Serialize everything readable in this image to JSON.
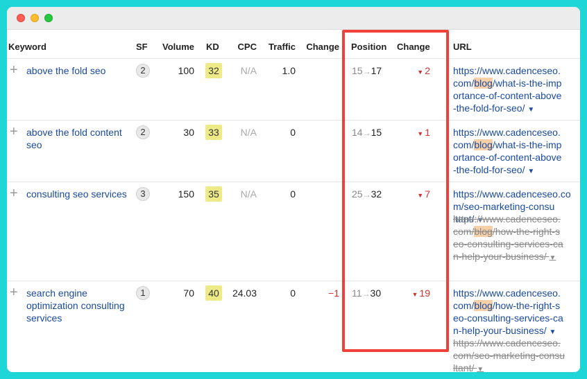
{
  "headers": {
    "keyword": "Keyword",
    "sf": "SF",
    "volume": "Volume",
    "kd": "KD",
    "cpc": "CPC",
    "traffic": "Traffic",
    "change": "Change",
    "position": "Position",
    "position_change": "Change",
    "url": "URL"
  },
  "icons": {
    "expand": "plus-icon",
    "down": "triangle-down-icon",
    "arrow": "right-arrow-icon",
    "dropdown": "caret-down-icon"
  },
  "colors": {
    "kd_badge": "#eeea88",
    "negative": "#d23030",
    "highlight_box": "#f0403a",
    "link": "#1a4aa0",
    "url_highlight": "#f7d0a8"
  },
  "rows": [
    {
      "keyword": "above the fold seo",
      "sf": "2",
      "volume": "100",
      "kd": "32",
      "cpc": "N/A",
      "traffic": "1.0",
      "change": "",
      "pos_from": "15",
      "pos_to": "17",
      "pos_change": "2",
      "urls": [
        {
          "pre": "https://www.cadenceseo.\ncom/",
          "hl": "blog",
          "post": "/what-is-the-imp\nortance-of-content-above\n-the-fold-for-seo/ ",
          "strike": false
        }
      ]
    },
    {
      "keyword": "above the fold content seo",
      "sf": "2",
      "volume": "30",
      "kd": "33",
      "cpc": "N/A",
      "traffic": "0",
      "change": "",
      "pos_from": "14",
      "pos_to": "15",
      "pos_change": "1",
      "urls": [
        {
          "pre": "https://www.cadenceseo.\ncom/",
          "hl": "blog",
          "post": "/what-is-the-imp\nortance-of-content-above\n-the-fold-for-seo/ ",
          "strike": false
        }
      ]
    },
    {
      "keyword": "consulting seo services",
      "sf": "3",
      "volume": "150",
      "kd": "35",
      "cpc": "N/A",
      "traffic": "0",
      "change": "",
      "pos_from": "25",
      "pos_to": "32",
      "pos_change": "7",
      "urls": [
        {
          "pre": "https://www.cadenceseo.com/seo-marketing-consu\nltant/ ",
          "hl": "",
          "post": "",
          "strike": false
        },
        {
          "pre": "https://www.cadenceseo.\ncom/",
          "hl": "blog",
          "post": "/how-the-right-s\neo-consulting-services-ca\nn-help-your-business/ ",
          "strike": true
        }
      ]
    },
    {
      "keyword": "search engine optimization consulting services",
      "sf": "1",
      "volume": "70",
      "kd": "40",
      "cpc": "24.03",
      "traffic": "0",
      "change": "−1",
      "pos_from": "11",
      "pos_to": "30",
      "pos_change": "19",
      "urls": [
        {
          "pre": "https://www.cadenceseo.\ncom/",
          "hl": "blog",
          "post": "/how-the-right-s\neo-consulting-services-ca\nn-help-your-business/ ",
          "strike": false
        },
        {
          "pre": "https://www.cadenceseo.\ncom/seo-marketing-consu\nltant/ ",
          "hl": "",
          "post": "",
          "strike": true
        }
      ]
    }
  ]
}
